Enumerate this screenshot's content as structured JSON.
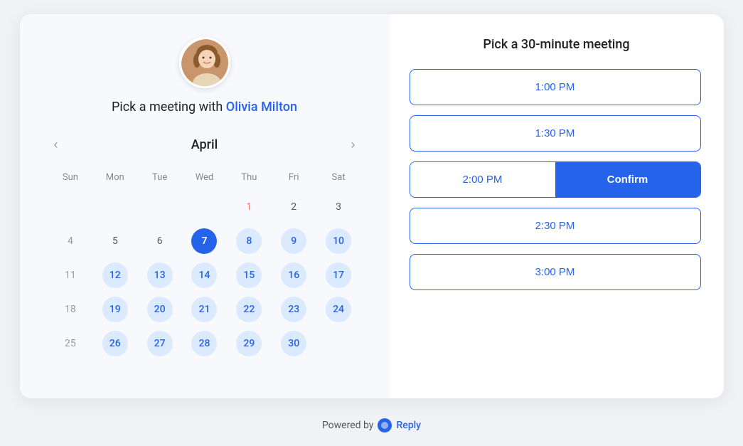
{
  "header": {
    "title": "Pick a meeting with",
    "name": "Olivia Milton"
  },
  "calendar": {
    "month": "April",
    "day_headers": [
      "Sun",
      "Mon",
      "Tue",
      "Wed",
      "Thu",
      "Fri",
      "Sat"
    ],
    "weeks": [
      [
        {
          "day": "",
          "type": "empty"
        },
        {
          "day": "",
          "type": "empty"
        },
        {
          "day": "",
          "type": "empty"
        },
        {
          "day": "",
          "type": "empty"
        },
        {
          "day": "1",
          "type": "other-month"
        },
        {
          "day": "2",
          "type": "normal"
        },
        {
          "day": "3",
          "type": "normal"
        }
      ],
      [
        {
          "day": "4",
          "type": "gray"
        },
        {
          "day": "5",
          "type": "normal"
        },
        {
          "day": "6",
          "type": "normal"
        },
        {
          "day": "7",
          "type": "today-selected"
        },
        {
          "day": "8",
          "type": "available"
        },
        {
          "day": "9",
          "type": "available"
        },
        {
          "day": "10",
          "type": "available"
        }
      ],
      [
        {
          "day": "11",
          "type": "gray"
        },
        {
          "day": "12",
          "type": "available"
        },
        {
          "day": "13",
          "type": "available"
        },
        {
          "day": "14",
          "type": "available"
        },
        {
          "day": "15",
          "type": "available"
        },
        {
          "day": "16",
          "type": "available"
        },
        {
          "day": "17",
          "type": "available"
        }
      ],
      [
        {
          "day": "18",
          "type": "gray"
        },
        {
          "day": "19",
          "type": "available"
        },
        {
          "day": "20",
          "type": "available"
        },
        {
          "day": "21",
          "type": "available"
        },
        {
          "day": "22",
          "type": "available"
        },
        {
          "day": "23",
          "type": "available"
        },
        {
          "day": "24",
          "type": "available"
        }
      ],
      [
        {
          "day": "25",
          "type": "gray"
        },
        {
          "day": "26",
          "type": "available"
        },
        {
          "day": "27",
          "type": "available"
        },
        {
          "day": "28",
          "type": "available"
        },
        {
          "day": "29",
          "type": "available"
        },
        {
          "day": "30",
          "type": "available"
        },
        {
          "day": "",
          "type": "empty"
        }
      ]
    ]
  },
  "right_panel": {
    "title": "Pick a 30-minute meeting",
    "time_slots": [
      {
        "time": "1:00 PM",
        "type": "single"
      },
      {
        "time": "1:30 PM",
        "type": "single"
      },
      {
        "time": "2:00 PM",
        "type": "split",
        "confirm": "Confirm"
      },
      {
        "time": "2:30 PM",
        "type": "single"
      },
      {
        "time": "3:00 PM",
        "type": "single"
      }
    ]
  },
  "footer": {
    "powered_by": "Powered by",
    "brand": "Reply"
  },
  "nav": {
    "prev": "‹",
    "next": "›"
  }
}
